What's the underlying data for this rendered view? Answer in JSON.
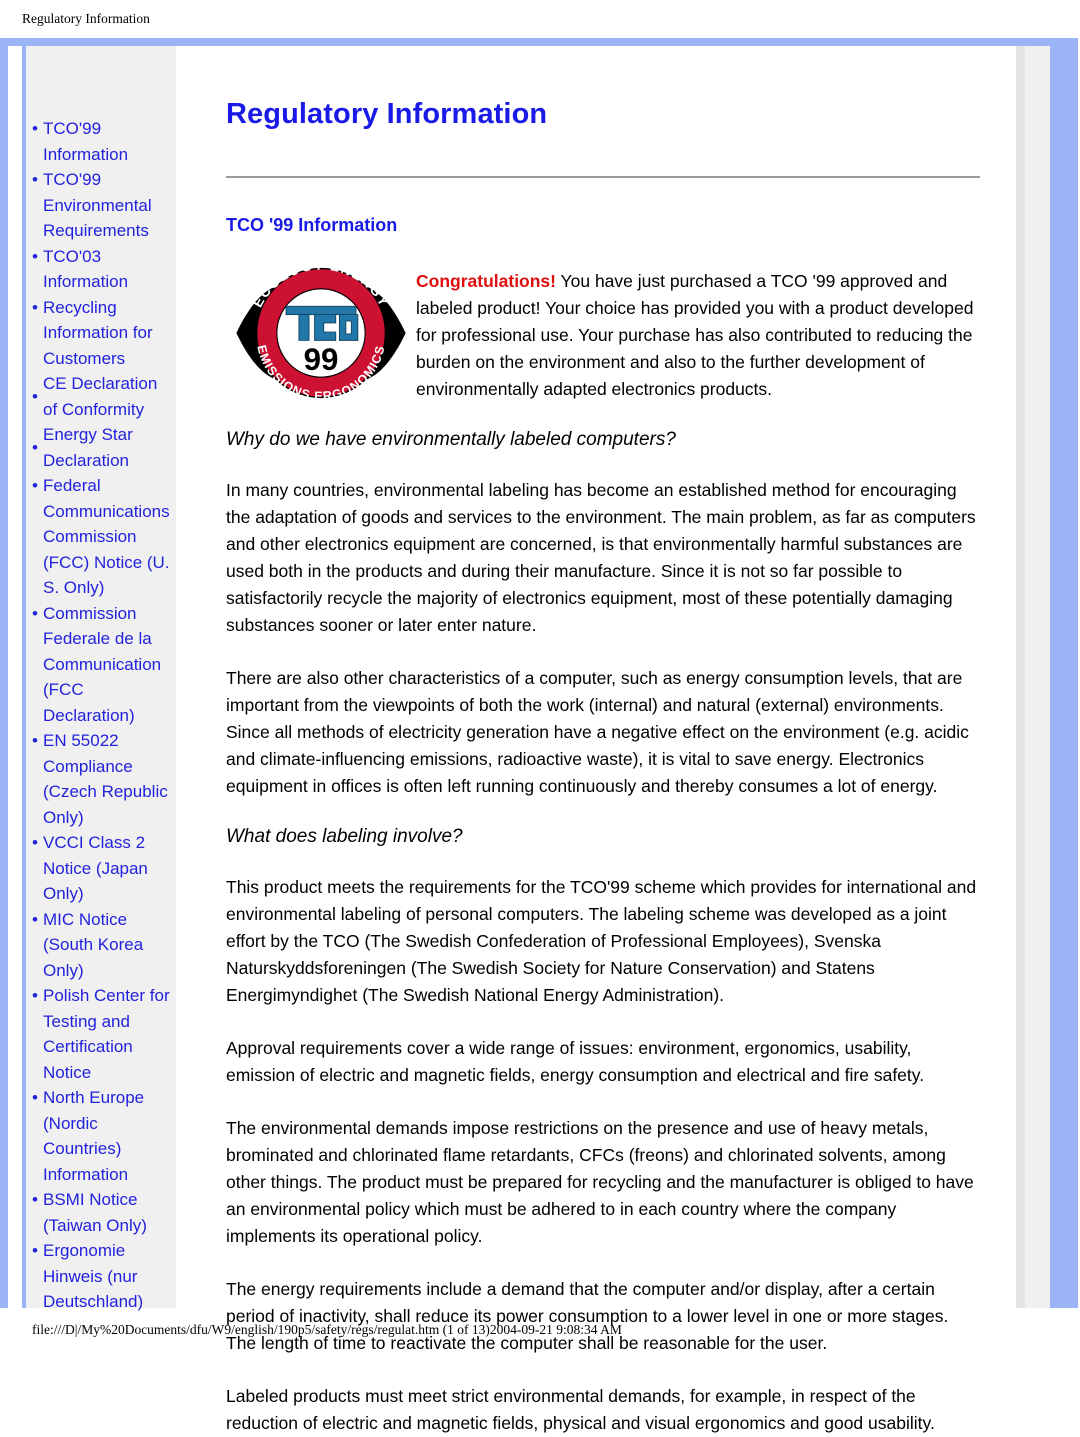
{
  "browser": {
    "header_title": "Regulatory Information",
    "footer_path": "file:///D|/My%20Documents/dfu/W9/english/190p5/safety/regs/regulat.htm (1 of 13)2004-09-21 9:08:34 AM"
  },
  "colors": {
    "frame_blue": "#9ab4f5",
    "link_blue": "#2222dd",
    "heading_blue": "#1a1ae6",
    "congrats_red": "#e01010",
    "sidebar_gray": "#f0f0f0",
    "rule_gray": "#9a9a9a",
    "logo_red": "#cc1133",
    "logo_blue": "#2277aa"
  },
  "sidebar": {
    "items": [
      {
        "label": "TCO'99 Information"
      },
      {
        "label": "TCO'99 Environmental Requirements"
      },
      {
        "label": "TCO'03 Information"
      },
      {
        "label": "Recycling Information for Customers"
      },
      {
        "label": "CE Declaration of Conformity"
      },
      {
        "label": "Energy Star Declaration"
      },
      {
        "label": "Federal Communications Commission (FCC) Notice (U. S. Only)"
      },
      {
        "label": "Commission Federale de la Communication (FCC Declaration)"
      },
      {
        "label": "EN 55022 Compliance (Czech Republic Only)"
      },
      {
        "label": "VCCI Class 2 Notice (Japan Only)"
      },
      {
        "label": "MIC Notice (South Korea Only)"
      },
      {
        "label": "Polish Center for Testing and Certification Notice"
      },
      {
        "label": "North Europe (Nordic Countries) Information"
      },
      {
        "label": "BSMI Notice (Taiwan Only)"
      },
      {
        "label": "Ergonomie Hinweis (nur Deutschland)"
      }
    ]
  },
  "main": {
    "page_title": "Regulatory Information",
    "section_title": "TCO '99 Information",
    "logo": {
      "top_arc_text": "ECOLOGY ENERGY",
      "bottom_arc_text": "EMISSIONS ERGONOMICS",
      "brand": "TCO",
      "year": "99"
    },
    "intro": {
      "lead": "Congratulations!",
      "rest": " You have just purchased a TCO '99 approved and labeled product! Your choice has provided you with a product developed for professional use. Your purchase has also contributed to reducing the burden on the environment and also to the further development of environmentally adapted electronics products."
    },
    "heading_why": "Why do we have environmentally labeled computers?",
    "para_1": "In many countries, environmental labeling has become an established method for encouraging the adaptation of goods and services to the environment. The main problem, as far as computers and other electronics equipment are concerned, is that environmentally harmful substances are used both in the products and during their manufacture. Since it is not so far possible to satisfactorily recycle the majority of electronics equipment, most of these potentially damaging substances sooner or later enter nature.",
    "para_2": "There are also other characteristics of a computer, such as energy consumption levels, that are important from the viewpoints of both the work (internal) and natural (external) environments. Since all methods of electricity generation have a negative effect on the environment (e.g. acidic and climate-influencing emissions, radioactive waste), it is vital to save energy. Electronics equipment in offices is often left running continuously and thereby consumes a lot of energy.",
    "heading_what": "What does labeling involve?",
    "para_3": "This product meets the requirements for the TCO'99 scheme which provides for international and environmental labeling of personal computers. The labeling scheme was developed as a joint effort by the TCO (The Swedish Confederation of Professional Employees), Svenska Naturskyddsforeningen (The Swedish Society for Nature Conservation) and Statens Energimyndighet (The Swedish National Energy Administration).",
    "para_4": "Approval requirements cover a wide range of issues: environment, ergonomics, usability, emission of electric and magnetic fields, energy consumption and electrical and fire safety.",
    "para_5": "The environmental demands impose restrictions on the presence and use of heavy metals, brominated and chlorinated flame retardants, CFCs (freons) and chlorinated solvents, among other things. The product must be prepared for recycling and the manufacturer is obliged to have an environmental policy which must be adhered to in each country where the company implements its operational policy.",
    "para_6": "The energy requirements include a demand that the computer and/or display, after a certain period of inactivity, shall reduce its power consumption to a lower level in one or more stages. The length of time to reactivate the computer shall be reasonable for the user.",
    "para_7": "Labeled products must meet strict environmental demands, for example, in respect of the reduction of electric and magnetic fields, physical and visual ergonomics and good usability."
  }
}
